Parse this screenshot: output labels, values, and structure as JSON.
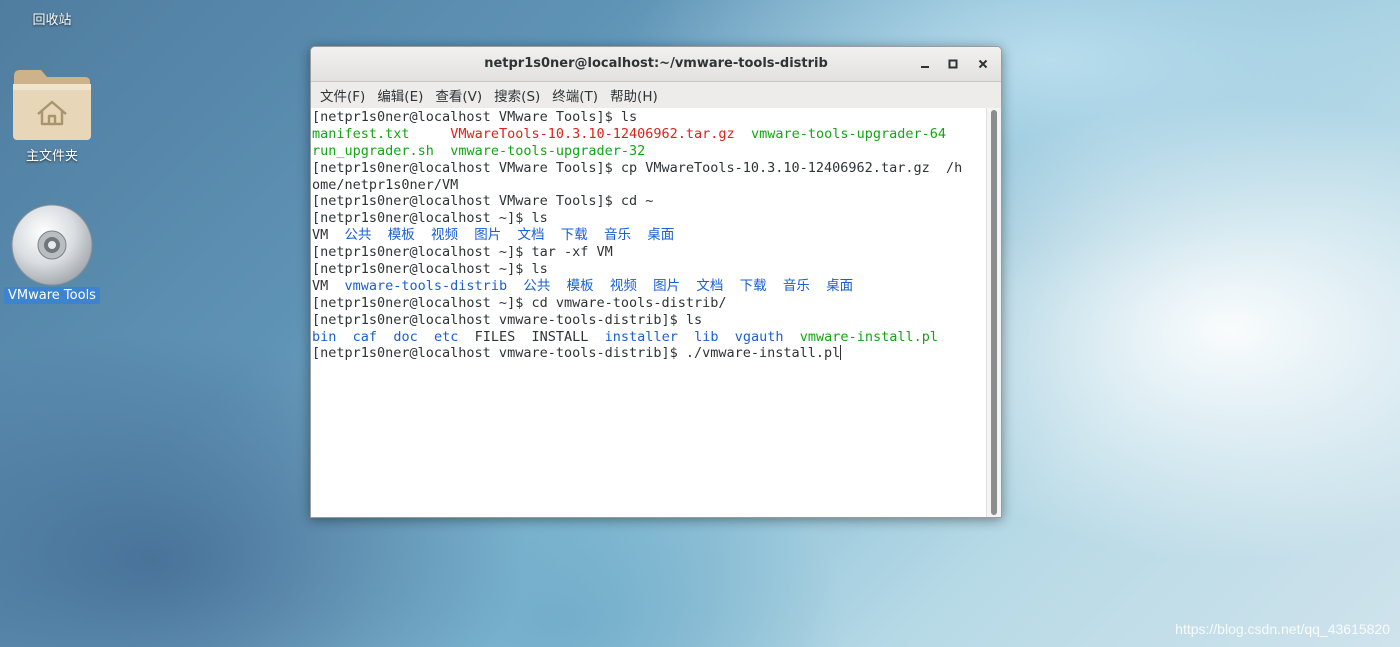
{
  "desktop": {
    "icons": [
      {
        "label": "回收站",
        "icon": "trash-icon"
      },
      {
        "label": "主文件夹",
        "icon": "home-folder-icon"
      },
      {
        "label": "VMware Tools",
        "icon": "cd-disc-icon"
      }
    ]
  },
  "window": {
    "title": "netpr1s0ner@localhost:~/vmware-tools-distrib",
    "buttons": {
      "minimize": "minimize-icon",
      "maximize": "maximize-icon",
      "close": "close-icon"
    },
    "menu": [
      "文件(F)",
      "编辑(E)",
      "查看(V)",
      "搜索(S)",
      "终端(T)",
      "帮助(H)"
    ]
  },
  "terminal": {
    "lines": [
      [
        {
          "t": "[netpr1s0ner@localhost VMware Tools]$ ls"
        }
      ],
      [
        {
          "t": "manifest.txt",
          "c": "green"
        },
        {
          "t": "     "
        },
        {
          "t": "VMwareTools-10.3.10-12406962.tar.gz",
          "c": "red"
        },
        {
          "t": "  "
        },
        {
          "t": "vmware-tools-upgrader-64",
          "c": "green"
        }
      ],
      [
        {
          "t": "run_upgrader.sh",
          "c": "green"
        },
        {
          "t": "  "
        },
        {
          "t": "vmware-tools-upgrader-32",
          "c": "green"
        }
      ],
      [
        {
          "t": "[netpr1s0ner@localhost VMware Tools]$ cp VMwareTools-10.3.10-12406962.tar.gz  /h"
        }
      ],
      [
        {
          "t": "ome/netpr1s0ner/VM"
        }
      ],
      [
        {
          "t": "[netpr1s0ner@localhost VMware Tools]$ cd ~"
        }
      ],
      [
        {
          "t": "[netpr1s0ner@localhost ~]$ ls"
        }
      ],
      [
        {
          "t": "VM  "
        },
        {
          "t": "公共  模板  视频  图片  文档  下载  音乐  桌面",
          "c": "blue"
        }
      ],
      [
        {
          "t": "[netpr1s0ner@localhost ~]$ tar -xf VM"
        }
      ],
      [
        {
          "t": "[netpr1s0ner@localhost ~]$ ls"
        }
      ],
      [
        {
          "t": "VM  "
        },
        {
          "t": "vmware-tools-distrib  公共  模板  视频  图片  文档  下载  音乐  桌面",
          "c": "blue"
        }
      ],
      [
        {
          "t": "[netpr1s0ner@localhost ~]$ cd vmware-tools-distrib/"
        }
      ],
      [
        {
          "t": "[netpr1s0ner@localhost vmware-tools-distrib]$ ls"
        }
      ],
      [
        {
          "t": "bin",
          "c": "blue"
        },
        {
          "t": "  "
        },
        {
          "t": "caf",
          "c": "blue"
        },
        {
          "t": "  "
        },
        {
          "t": "doc",
          "c": "blue"
        },
        {
          "t": "  "
        },
        {
          "t": "etc",
          "c": "blue"
        },
        {
          "t": "  FILES  INSTALL  "
        },
        {
          "t": "installer",
          "c": "blue"
        },
        {
          "t": "  "
        },
        {
          "t": "lib",
          "c": "blue"
        },
        {
          "t": "  "
        },
        {
          "t": "vgauth",
          "c": "blue"
        },
        {
          "t": "  "
        },
        {
          "t": "vmware-install.pl",
          "c": "green"
        }
      ],
      [
        {
          "t": "[netpr1s0ner@localhost vmware-tools-distrib]$ ./vmware-install.pl"
        }
      ]
    ]
  },
  "colors": {
    "green": "#14a514",
    "red": "#e0201c",
    "blue": "#1a5fd4",
    "selection": "#3c83d0"
  },
  "watermark": "https://blog.csdn.net/qq_43615820"
}
